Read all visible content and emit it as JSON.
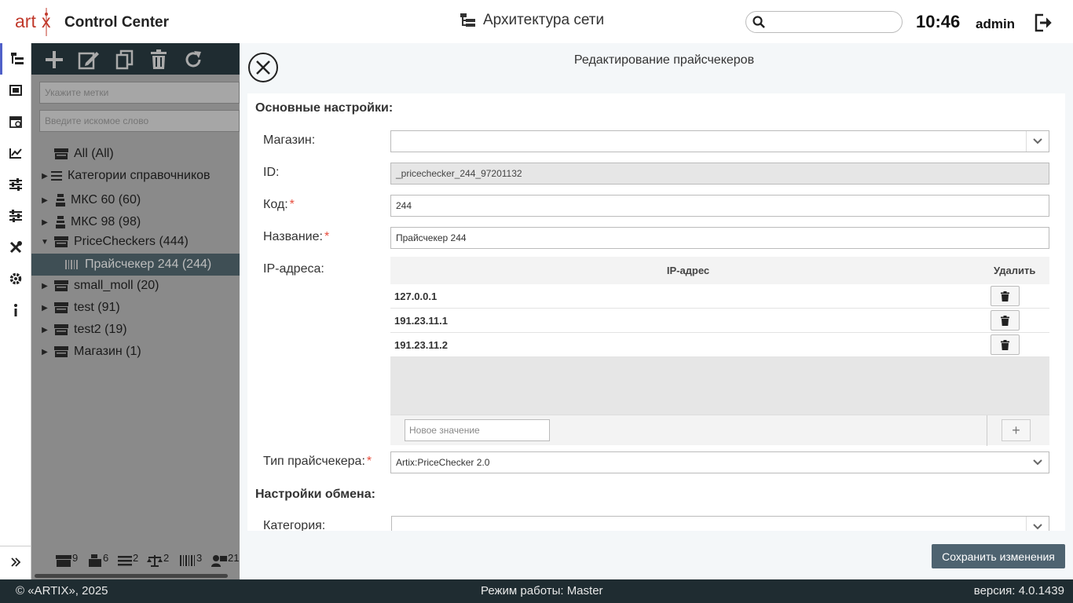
{
  "header": {
    "logo_text": "artix",
    "app_title": "Control Center",
    "page_title": "Архитектура сети",
    "search_placeholder": "",
    "clock": "10:46",
    "user": "admin"
  },
  "iconbar": {
    "items": [
      "tree-icon",
      "layout-icon",
      "calendar-icon",
      "chart-icon",
      "sliders-icon",
      "sliders-alt-icon",
      "tools-icon",
      "gear-icon",
      "info-icon"
    ],
    "expand_icon": "double-chevron-right-icon"
  },
  "tree": {
    "tags_placeholder": "Укажите метки",
    "search_placeholder": "Введите искомое слово",
    "items": [
      {
        "label": "All (All)",
        "expandable": false
      },
      {
        "label": "Категории справочников",
        "expandable": true
      },
      {
        "label": "МКС 60 (60)",
        "expandable": true
      },
      {
        "label": "МКС 98 (98)",
        "expandable": true
      },
      {
        "label": "PriceCheckers (444)",
        "expandable": true,
        "expanded": true
      },
      {
        "label": "Прайсчекер 244 (244)",
        "selected": true
      },
      {
        "label": "small_moll (20)",
        "expandable": true
      },
      {
        "label": "test (91)",
        "expandable": true
      },
      {
        "label": "test2 (19)",
        "expandable": true
      },
      {
        "label": "Магазин (1)",
        "expandable": true
      }
    ],
    "footer_counts": [
      {
        "icon": "store-icon",
        "count": "9"
      },
      {
        "icon": "cash-register-icon",
        "count": "6"
      },
      {
        "icon": "list-icon",
        "count": "2"
      },
      {
        "icon": "scales-icon",
        "count": "2"
      },
      {
        "icon": "barcode-icon",
        "count": "3"
      },
      {
        "icon": "terminal-icon",
        "count": "21"
      }
    ]
  },
  "modal": {
    "title": "Редактирование прайсчекеров",
    "section_main": "Основные настройки:",
    "fields": {
      "store": {
        "label": "Магазин:",
        "value": ""
      },
      "id": {
        "label": "ID:",
        "value": "_pricechecker_244_97201132"
      },
      "code": {
        "label": "Код:",
        "value": "244"
      },
      "name": {
        "label": "Название:",
        "value": "Прайсчекер 244"
      },
      "ips": {
        "label": "IP-адреса:"
      },
      "type": {
        "label": "Тип прайсчекера:",
        "value": "Artix:PriceChecker 2.0"
      },
      "category": {
        "label": "Категория:",
        "value": ""
      }
    },
    "required_mark": "*",
    "ip_table": {
      "col_ip": "IP-адрес",
      "col_delete": "Удалить",
      "rows": [
        "127.0.0.1",
        "191.23.11.1",
        "191.23.11.2"
      ],
      "new_placeholder": "Новое значение",
      "add_label": "+"
    },
    "section_exchange": "Настройки обмена:",
    "save_label": "Сохранить изменения"
  },
  "footer": {
    "copyright": "© «ARTIX», 2025",
    "mode": "Режим работы: Master",
    "version": "версия: 4.0.1439"
  }
}
